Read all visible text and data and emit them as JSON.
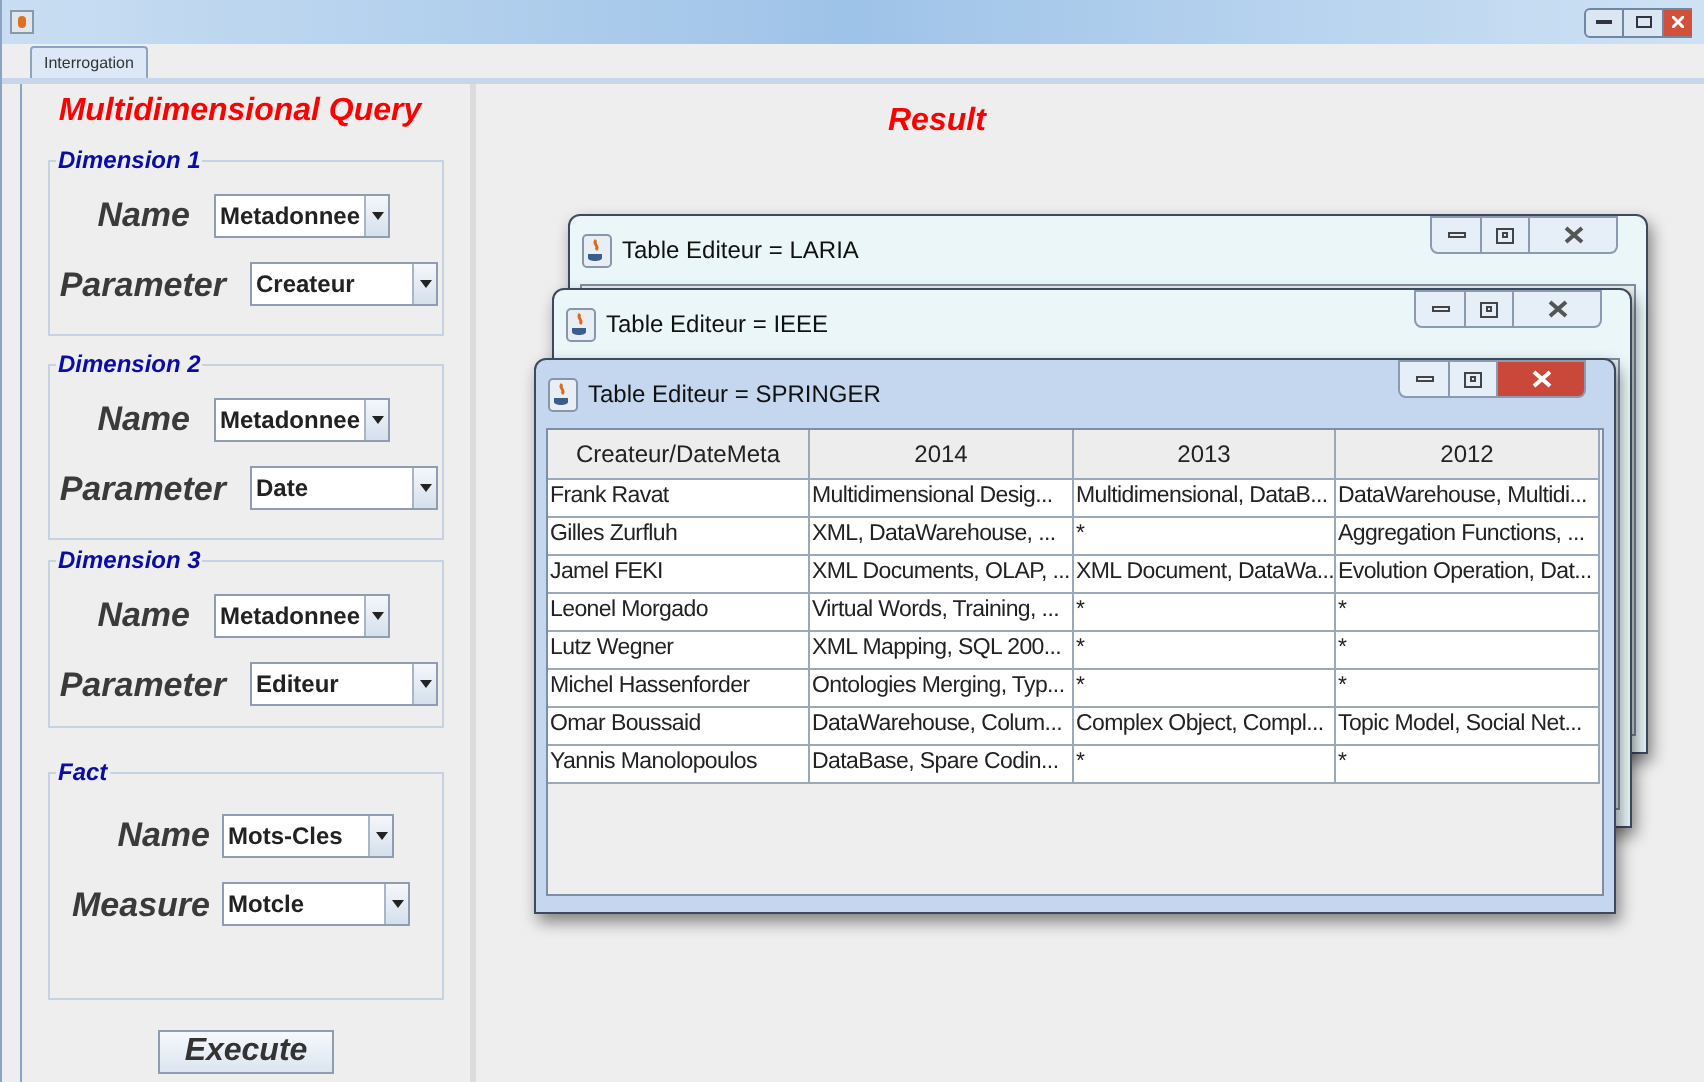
{
  "tabs": [
    {
      "label": "Interrogation",
      "selected": true
    }
  ],
  "query_panel": {
    "title": "Multidimensional Query",
    "groups": [
      {
        "legend": "Dimension 1",
        "fields": [
          {
            "label": "Name",
            "value": "Metadonnee"
          },
          {
            "label": "Parameter",
            "value": "Createur"
          }
        ]
      },
      {
        "legend": "Dimension 2",
        "fields": [
          {
            "label": "Name",
            "value": "Metadonnee"
          },
          {
            "label": "Parameter",
            "value": "Date"
          }
        ]
      },
      {
        "legend": "Dimension 3",
        "fields": [
          {
            "label": "Name",
            "value": "Metadonnee"
          },
          {
            "label": "Parameter",
            "value": "Editeur"
          }
        ]
      },
      {
        "legend": "Fact",
        "fields": [
          {
            "label": "Name",
            "value": "Mots-Cles"
          },
          {
            "label": "Measure",
            "value": "Motcle"
          }
        ]
      }
    ],
    "execute_button": "Execute"
  },
  "result_panel": {
    "title": "Result",
    "windows": [
      {
        "title": "Table Editeur = LARIA",
        "active": false
      },
      {
        "title": "Table Editeur = IEEE",
        "active": false
      },
      {
        "title": "Table Editeur = SPRINGER",
        "active": true,
        "table": {
          "columns": [
            "Createur/DateMeta",
            "2014",
            "2013",
            "2012"
          ],
          "rows": [
            [
              "Frank Ravat",
              "Multidimensional Desig...",
              "Multidimensional, DataB...",
              "DataWarehouse, Multidi..."
            ],
            [
              "Gilles Zurfluh",
              "XML, DataWarehouse, ...",
              "*",
              "Aggregation Functions, ..."
            ],
            [
              "Jamel FEKI",
              "XML Documents, OLAP, ...",
              "XML Document, DataWa...",
              "Evolution Operation, Dat..."
            ],
            [
              "Leonel Morgado",
              "Virtual Words, Training, ...",
              "*",
              "*"
            ],
            [
              "Lutz Wegner",
              "XML Mapping, SQL 200...",
              "*",
              "*"
            ],
            [
              "Michel Hassenforder",
              "Ontologies Merging, Typ...",
              "*",
              "*"
            ],
            [
              "Omar Boussaid",
              "DataWarehouse, Colum...",
              "Complex Object, Compl...",
              "Topic Model, Social Net..."
            ],
            [
              "Yannis Manolopoulos",
              "DataBase, Spare Codin...",
              "*",
              "*"
            ]
          ]
        }
      }
    ]
  }
}
